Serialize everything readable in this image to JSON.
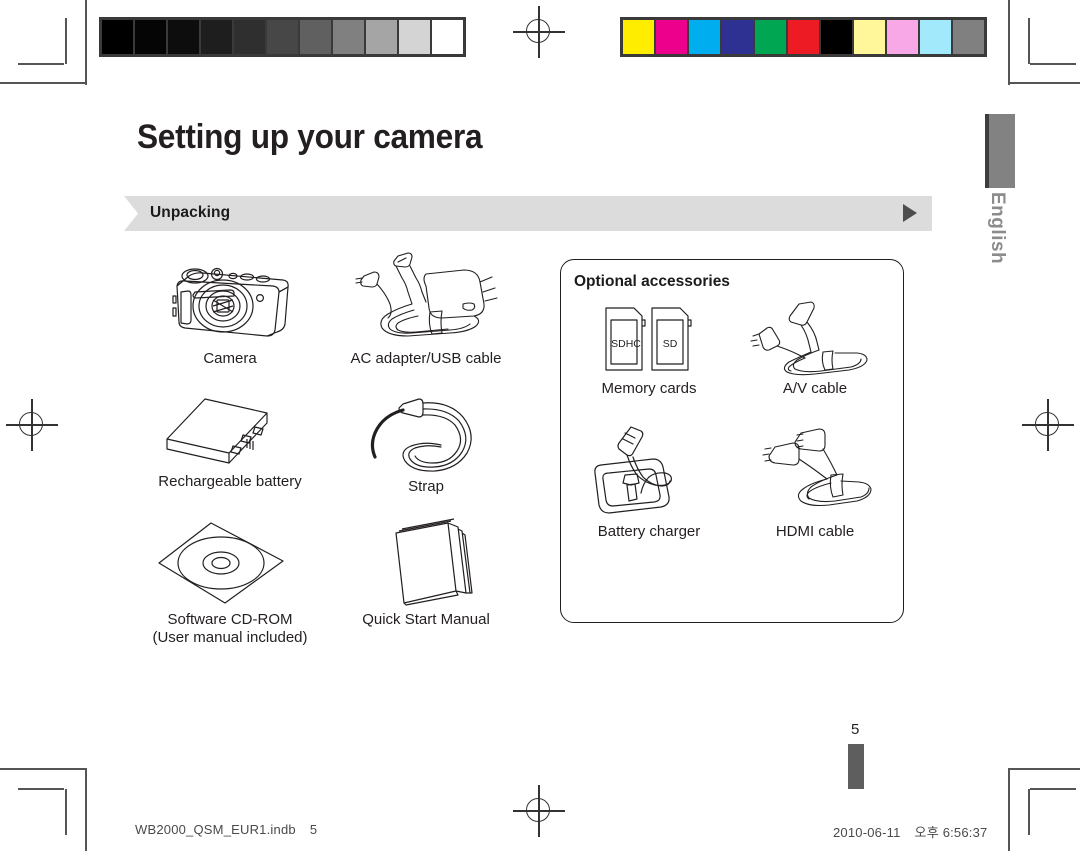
{
  "document": {
    "page_title": "Setting up your camera",
    "section_label": "Unpacking",
    "language_tab": "English",
    "page_number": "5",
    "footer_filename": "WB2000_QSM_EUR1.indb",
    "footer_file_page": "5",
    "footer_date": "2010-06-11",
    "footer_meridiem": "오후",
    "footer_time": "6:56:37"
  },
  "included_items": [
    {
      "label": "Camera",
      "icon": "camera-icon"
    },
    {
      "label": "AC adapter/USB cable",
      "icon": "ac-adapter-usb-cable-icon"
    },
    {
      "label": "Rechargeable battery",
      "icon": "battery-icon"
    },
    {
      "label": "Strap",
      "icon": "strap-icon"
    },
    {
      "label": "Software CD-ROM\n(User manual included)",
      "icon": "cd-rom-icon"
    },
    {
      "label": "Quick Start Manual",
      "icon": "manual-icon"
    }
  ],
  "included_labels": {
    "camera": "Camera",
    "ac_adapter": "AC adapter/USB cable",
    "battery": "Rechargeable battery",
    "strap": "Strap",
    "cdrom_line1": "Software CD-ROM",
    "cdrom_line2": "(User manual included)",
    "manual": "Quick Start Manual"
  },
  "optional": {
    "title": "Optional accessories",
    "memory_cards": "Memory cards",
    "memory_card_sdhc": "SDHC",
    "memory_card_sd": "SD",
    "av_cable": "A/V cable",
    "battery_charger": "Battery charger",
    "hdmi_cable": "HDMI cable"
  },
  "calibration": {
    "grayscale_patches": [
      "#000000",
      "#050505",
      "#0d0d0d",
      "#1e1e1e",
      "#2f2f2f",
      "#474747",
      "#606060",
      "#808080",
      "#a5a5a5",
      "#d4d4d4",
      "#ffffff"
    ],
    "color_patches": [
      "#ffed00",
      "#ec008c",
      "#00aeef",
      "#2e3192",
      "#00a651",
      "#ed1c24",
      "#000000",
      "#fff79a",
      "#f9a8e7",
      "#a1e9fb",
      "#808080"
    ]
  },
  "theme": {
    "banner_gray": "#dcdcdc",
    "tab_gray": "#828282",
    "ink": "#231f20"
  }
}
